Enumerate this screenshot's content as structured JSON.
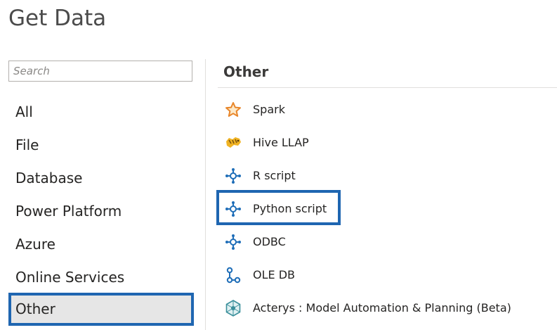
{
  "dialog": {
    "title": "Get Data"
  },
  "search": {
    "placeholder": "Search",
    "value": ""
  },
  "categories": [
    {
      "label": "All",
      "selected": false
    },
    {
      "label": "File",
      "selected": false
    },
    {
      "label": "Database",
      "selected": false
    },
    {
      "label": "Power Platform",
      "selected": false
    },
    {
      "label": "Azure",
      "selected": false
    },
    {
      "label": "Online Services",
      "selected": false
    },
    {
      "label": "Other",
      "selected": true
    }
  ],
  "content": {
    "heading": "Other",
    "connectors": [
      {
        "label": "Spark",
        "icon": "star-icon"
      },
      {
        "label": "Hive LLAP",
        "icon": "hive-bee-icon"
      },
      {
        "label": "R script",
        "icon": "script-connector-icon"
      },
      {
        "label": "Python script",
        "icon": "script-connector-icon",
        "highlighted": true
      },
      {
        "label": "ODBC",
        "icon": "script-connector-icon"
      },
      {
        "label": "OLE DB",
        "icon": "ole-db-icon"
      },
      {
        "label": "Acterys : Model Automation & Planning (Beta)",
        "icon": "acterys-icon"
      }
    ]
  },
  "colors": {
    "accent_border": "#1f66b1",
    "selected_bg": "#e6e6e6",
    "connector_icon_blue": "#1f6eb8",
    "star_orange": "#e8862a"
  }
}
